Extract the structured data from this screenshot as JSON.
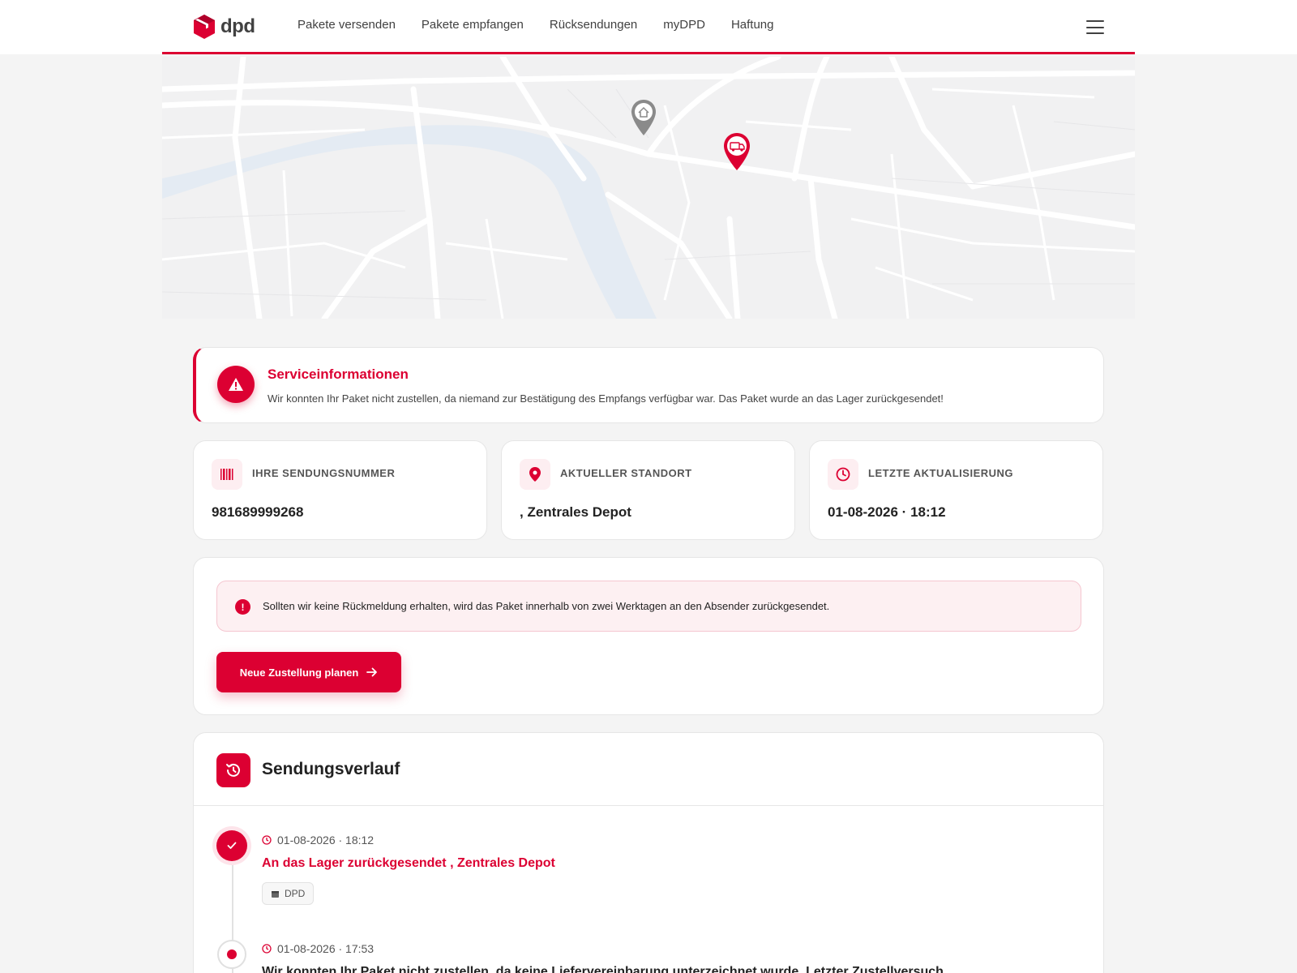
{
  "header": {
    "logo_text": "dpd",
    "nav": [
      "Pakete versenden",
      "Pakete empfangen",
      "Rücksendungen",
      "myDPD",
      "Haftung"
    ]
  },
  "map": {
    "pins": [
      "home-pin-icon",
      "delivery-van-pin-icon"
    ]
  },
  "service": {
    "title": "Serviceinformationen",
    "text": "Wir konnten Ihr Paket nicht zustellen, da niemand zur Bestätigung des Empfangs verfügbar war. Das Paket wurde an das Lager zurückgesendet!"
  },
  "info": {
    "tracking_label": "IHRE SENDUNGSNUMMER",
    "tracking_value": "981689999268",
    "location_label": "AKTUELLER STANDORT",
    "location_value": ", Zentrales Depot",
    "updated_label": "LETZTE AKTUALISIERUNG",
    "updated_value": "01-08-2026 · 18:12"
  },
  "action": {
    "notice": "Sollten wir keine Rückmeldung erhalten, wird das Paket innerhalb von zwei Werktagen an den Absender zurückgesendet.",
    "button_label": "Neue Zustellung planen"
  },
  "history": {
    "title": "Sendungsverlauf",
    "events": [
      {
        "time": "01-08-2026 · 18:12",
        "title": "An das Lager zurückgesendet , Zentrales Depot",
        "tag": "DPD"
      },
      {
        "time": "01-08-2026 · 17:53",
        "title": "Wir konnten Ihr Paket nicht zustellen, da keine Liefervereinbarung unterzeichnet wurde. Letzter Zustellversuch"
      }
    ]
  },
  "colors": {
    "brand": "#dc0032",
    "text": "#222222",
    "background": "#f4f4f4"
  }
}
